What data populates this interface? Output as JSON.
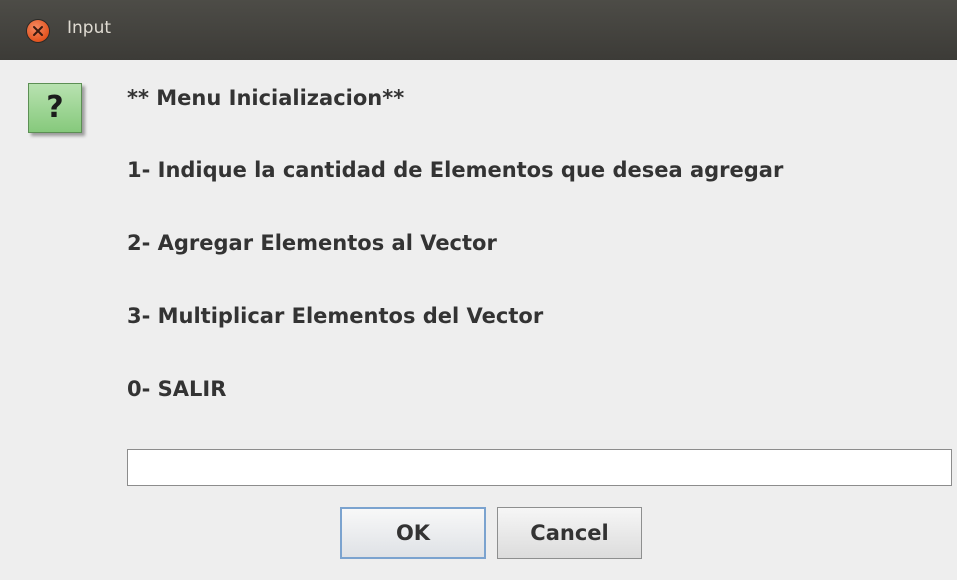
{
  "window": {
    "title": "Input",
    "close_icon": "close-icon"
  },
  "dialog": {
    "icon": "question-icon",
    "icon_glyph": "?",
    "icon_color": "#8fcf84",
    "lines": [
      "** Menu Inicializacion**",
      "1- Indique la cantidad de Elementos que desea agregar",
      "2- Agregar Elementos al Vector",
      "3- Multiplicar Elementos del Vector",
      "0- SALIR"
    ],
    "input_value": ""
  },
  "buttons": {
    "ok_label": "OK",
    "cancel_label": "Cancel"
  },
  "colors": {
    "titlebar": "#3c3b37",
    "close_button": "#e3541f",
    "background": "#eeeeee",
    "focus_border": "#7ba3cf"
  }
}
